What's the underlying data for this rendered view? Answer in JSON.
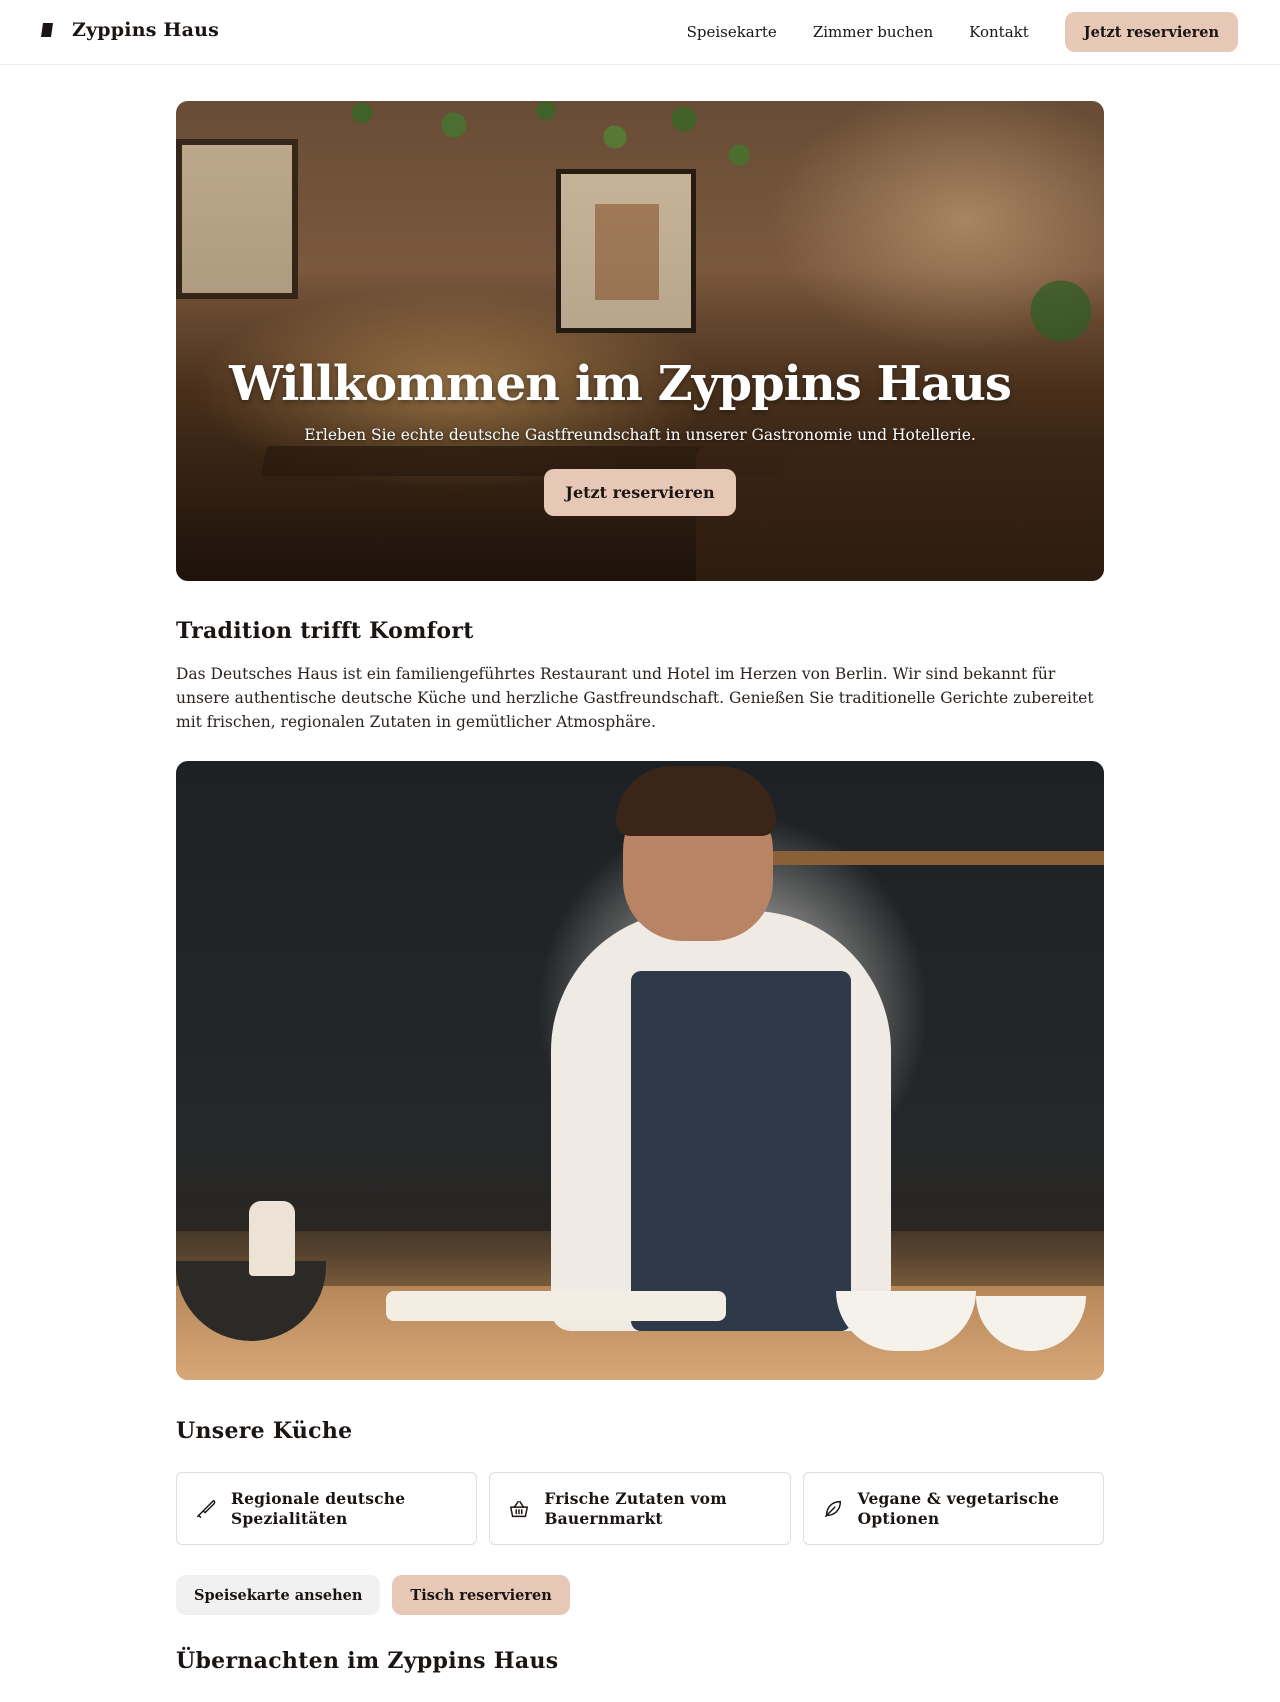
{
  "header": {
    "brand_name": "Zyppins Haus",
    "nav": [
      "Speisekarte",
      "Zimmer buchen",
      "Kontakt"
    ],
    "cta_label": "Jetzt reservieren"
  },
  "hero": {
    "title": "Willkommen im Zyppins Haus",
    "subtitle": "Erleben Sie echte deutsche Gastfreundschaft in unserer Gastronomie und Hotellerie.",
    "cta_label": "Jetzt reservieren"
  },
  "intro": {
    "heading": "Tradition trifft Komfort",
    "text": "Das Deutsches Haus ist ein familiengeführtes Restaurant und Hotel im Herzen von Berlin. Wir sind bekannt für unsere authentische deutsche Küche und herzliche Gastfreundschaft. Genießen Sie traditionelle Gerichte zubereitet mit frischen, regionalen Zutaten in gemütlicher Atmosphäre."
  },
  "kitchen": {
    "heading": "Unsere Küche",
    "features": [
      {
        "icon": "knife-icon",
        "label": "Regionale deutsche Spezialitäten"
      },
      {
        "icon": "basket-icon",
        "label": "Frische Zutaten vom Bauernmarkt"
      },
      {
        "icon": "leaf-icon",
        "label": "Vegane & vegetarische Optionen"
      }
    ],
    "buttons": {
      "menu_label": "Speisekarte ansehen",
      "reserve_label": "Tisch reservieren"
    }
  },
  "stay": {
    "heading": "Übernachten im Zyppins Haus"
  },
  "colors": {
    "accent": "#e7c7b5",
    "secondary_button": "#f1f1f1",
    "text": "#1a1512"
  }
}
